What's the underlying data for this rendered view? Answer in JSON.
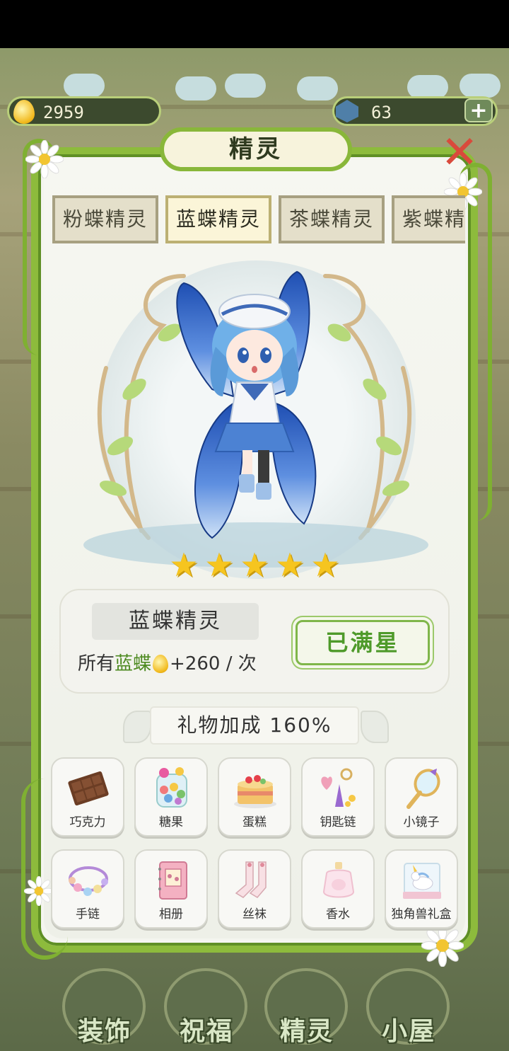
{
  "currency": {
    "coins": "2959",
    "gems": "63",
    "add_label": "+"
  },
  "dialog": {
    "title": "精灵",
    "close_label": "✕"
  },
  "tabs": [
    {
      "label": "粉蝶精灵",
      "active": false
    },
    {
      "label": "蓝蝶精灵",
      "active": true
    },
    {
      "label": "茶蝶精灵",
      "active": false
    },
    {
      "label": "紫蝶精灵",
      "active": false
    }
  ],
  "fairy": {
    "name": "蓝蝶精灵",
    "stars": 5,
    "bonus_prefix": "所有",
    "bonus_target": "蓝蝶",
    "bonus_value": "+260",
    "bonus_suffix": "/ 次",
    "status_button": "已满星"
  },
  "gift_bonus": {
    "label": "礼物加成",
    "value": "160%"
  },
  "gifts": [
    {
      "label": "巧克力",
      "icon": "chocolate-icon"
    },
    {
      "label": "糖果",
      "icon": "candy-jar-icon"
    },
    {
      "label": "蛋糕",
      "icon": "cake-icon"
    },
    {
      "label": "钥匙链",
      "icon": "keychain-icon"
    },
    {
      "label": "小镜子",
      "icon": "hand-mirror-icon"
    },
    {
      "label": "手链",
      "icon": "bracelet-icon"
    },
    {
      "label": "相册",
      "icon": "photo-album-icon"
    },
    {
      "label": "丝袜",
      "icon": "stockings-icon"
    },
    {
      "label": "香水",
      "icon": "perfume-icon"
    },
    {
      "label": "独角兽礼盒",
      "icon": "unicorn-giftbox-icon"
    }
  ],
  "bottom_nav": [
    {
      "label": "装饰"
    },
    {
      "label": "祝福"
    },
    {
      "label": "精灵"
    },
    {
      "label": "小屋"
    }
  ],
  "colors": {
    "vine_green": "#8dbb3c",
    "panel_bg": "#f4f5ef",
    "star_gold": "#f6c51f",
    "status_green": "#4e9a2a",
    "close_red": "#d94a3c"
  }
}
